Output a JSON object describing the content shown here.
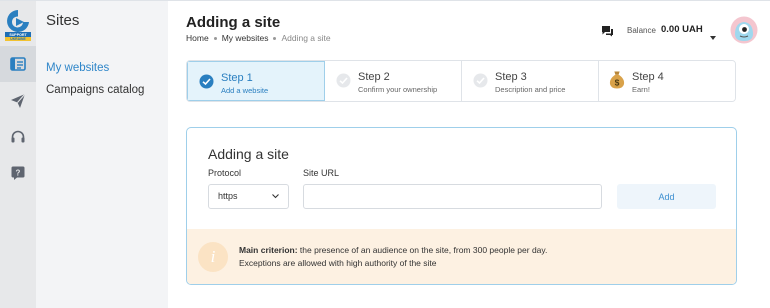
{
  "app": {
    "logo_text_line1": "SUPPORT",
    "logo_text_line2": "UKRAINE",
    "brand_color": "#2a7fc0"
  },
  "rail": {
    "items": [
      {
        "icon": "websites-list-icon",
        "active": true
      },
      {
        "icon": "send-icon",
        "active": false
      },
      {
        "icon": "headset-icon",
        "active": false
      },
      {
        "icon": "help-icon",
        "active": false
      }
    ]
  },
  "sidebar": {
    "title": "Sites",
    "items": [
      {
        "label": "My websites",
        "active": true
      },
      {
        "label": "Campaigns catalog",
        "active": false
      }
    ]
  },
  "header": {
    "title": "Adding a site",
    "breadcrumb": [
      "Home",
      "My websites",
      "Adding a site"
    ],
    "balance_label": "Balance",
    "balance_value": "0.00 UAH"
  },
  "steps": [
    {
      "title": "Step 1",
      "subtitle": "Add a website",
      "state": "active",
      "icon": "check-circle-icon"
    },
    {
      "title": "Step 2",
      "subtitle": "Confirm your ownership",
      "state": "pending",
      "icon": "check-circle-icon"
    },
    {
      "title": "Step 3",
      "subtitle": "Description and price",
      "state": "pending",
      "icon": "check-circle-icon"
    },
    {
      "title": "Step 4",
      "subtitle": "Earn!",
      "state": "pending",
      "icon": "money-bag-icon"
    }
  ],
  "form": {
    "title": "Adding a site",
    "protocol_label": "Protocol",
    "protocol_value": "https",
    "url_label": "Site URL",
    "url_value": "",
    "add_label": "Add"
  },
  "notice": {
    "bold": "Main criterion:",
    "line1": " the presence of an audience on the site, from 300 people per day.",
    "line2": "Exceptions are allowed with high authority of the site"
  }
}
